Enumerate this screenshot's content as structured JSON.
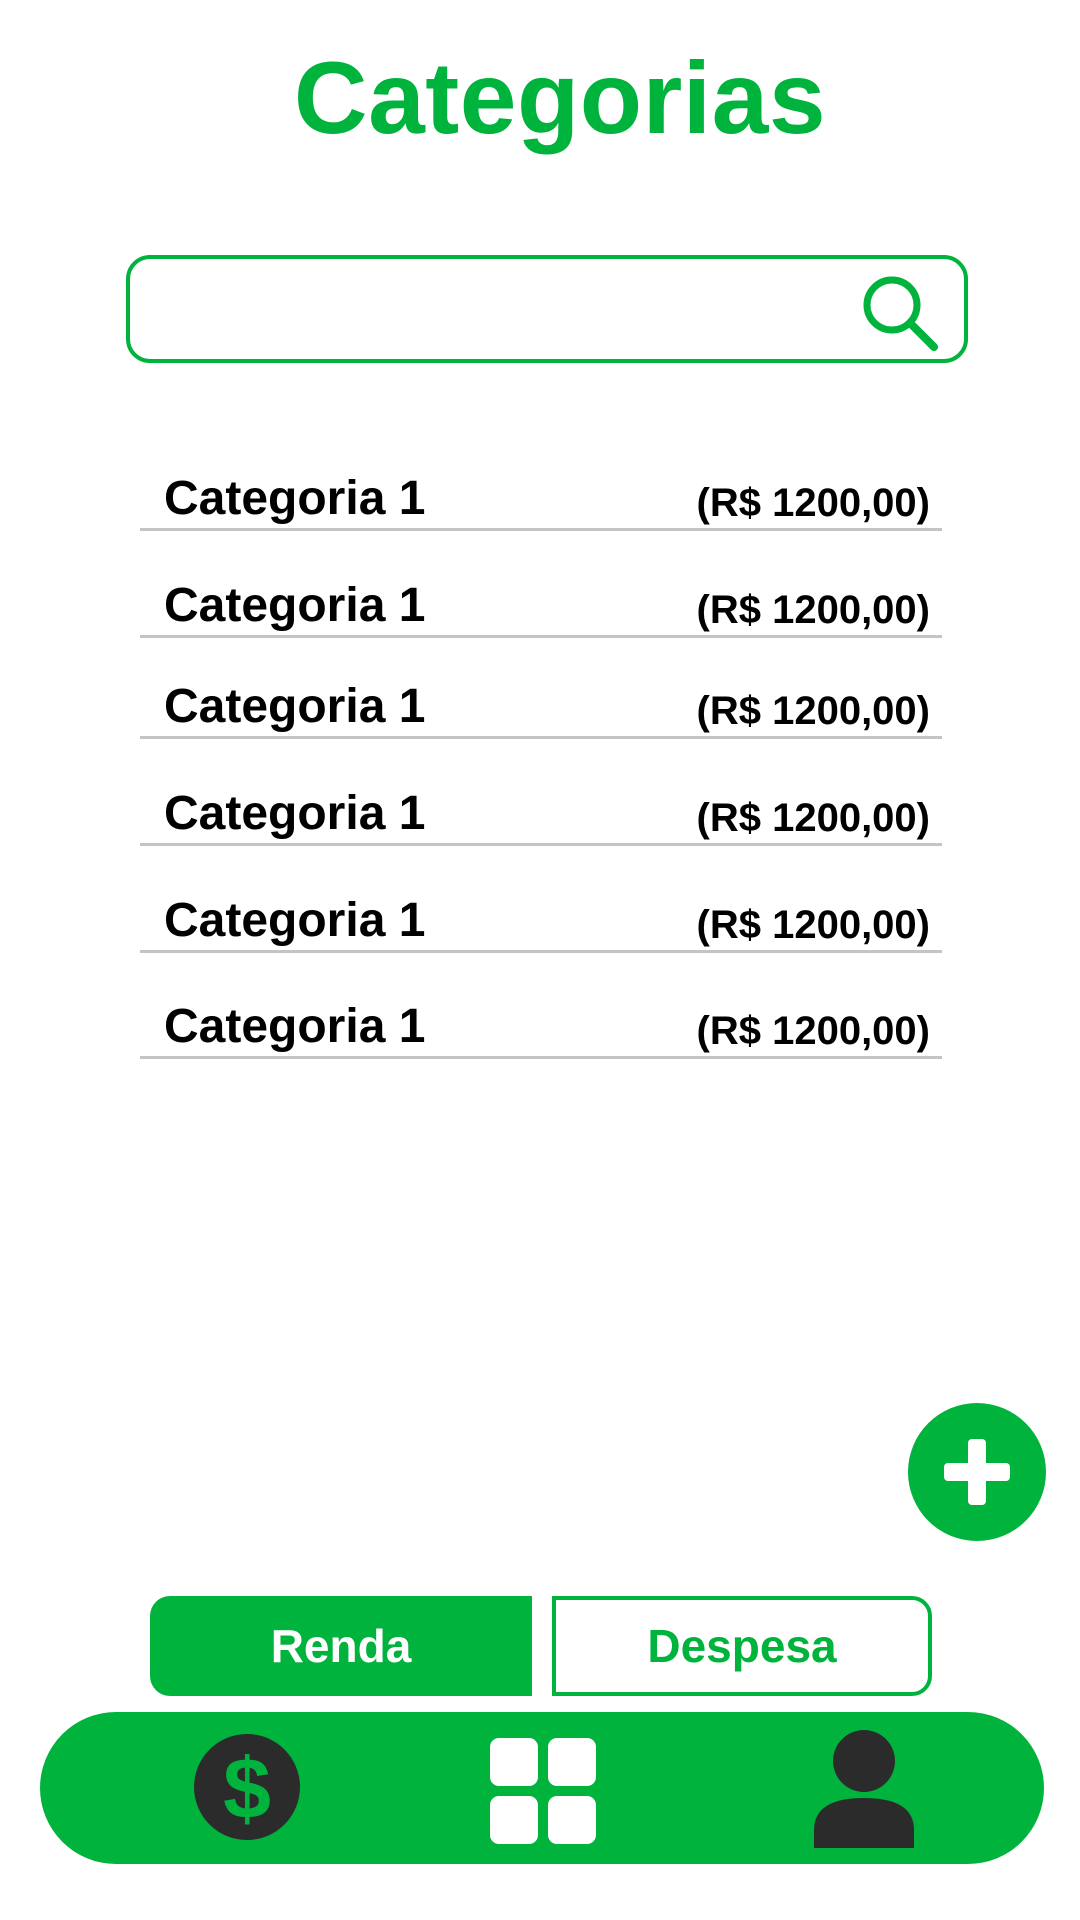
{
  "header": {
    "title": "Categorias"
  },
  "search": {
    "value": "",
    "placeholder": "",
    "icon": "search-icon"
  },
  "categories": [
    {
      "name": "Categoria 1",
      "value": "(R$ 1200,00)"
    },
    {
      "name": "Categoria 1",
      "value": "(R$ 1200,00)"
    },
    {
      "name": "Categoria 1",
      "value": "(R$ 1200,00)"
    },
    {
      "name": "Categoria 1",
      "value": "(R$ 1200,00)"
    },
    {
      "name": "Categoria 1",
      "value": "(R$ 1200,00)"
    },
    {
      "name": "Categoria 1",
      "value": "(R$ 1200,00)"
    }
  ],
  "fab": {
    "icon": "plus-icon"
  },
  "segmented": {
    "income_label": "Renda",
    "expense_label": "Despesa",
    "selected": "Renda"
  },
  "bottom_nav": {
    "items": [
      {
        "icon": "dollar-icon"
      },
      {
        "icon": "grid-icon"
      },
      {
        "icon": "user-icon"
      }
    ]
  },
  "colors": {
    "accent": "#00b33c",
    "icon_dark": "#2b2b2b",
    "divider": "#c4c4c4"
  }
}
